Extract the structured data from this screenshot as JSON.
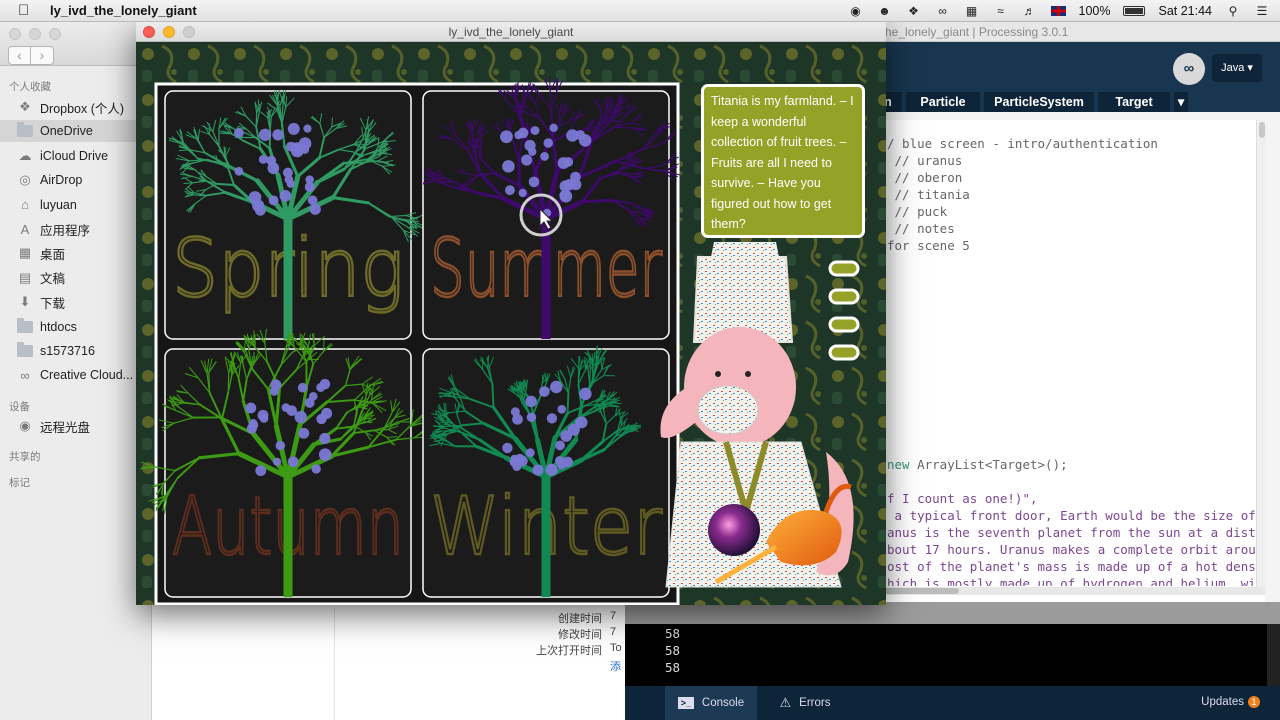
{
  "menubar": {
    "app_name": "ly_ivd_the_lonely_giant",
    "battery": "100%",
    "clock": "Sat 21:44"
  },
  "finder": {
    "sections": {
      "favorites": "个人收藏",
      "devices": "设备",
      "shared": "共享的",
      "tags": "标记"
    },
    "favorites": [
      {
        "label": "Dropbox (个人)",
        "icon": "dropbox-icon"
      },
      {
        "label": "OneDrive",
        "icon": "folder-icon",
        "selected": true
      },
      {
        "label": "iCloud Drive",
        "icon": "cloud-icon"
      },
      {
        "label": "AirDrop",
        "icon": "airdrop-icon"
      },
      {
        "label": "luyuan",
        "icon": "home-icon"
      },
      {
        "label": "应用程序",
        "icon": "applications-icon"
      },
      {
        "label": "桌面",
        "icon": "desktop-icon"
      },
      {
        "label": "文稿",
        "icon": "documents-icon"
      },
      {
        "label": "下载",
        "icon": "downloads-icon"
      },
      {
        "label": "htdocs",
        "icon": "folder-icon"
      },
      {
        "label": "s1573716",
        "icon": "folder-icon"
      },
      {
        "label": "Creative Cloud...",
        "icon": "creative-cloud-icon"
      }
    ],
    "devices": [
      {
        "label": "远程光盘",
        "icon": "disc-icon"
      }
    ],
    "info": [
      {
        "label": "创建时间",
        "value": "7"
      },
      {
        "label": "修改时间",
        "value": "7"
      },
      {
        "label": "上次打开时间",
        "value": "To"
      },
      {
        "label": "",
        "value": "添"
      }
    ]
  },
  "ide": {
    "title": "he_lonely_giant | Processing 3.0.1",
    "mode_icon": "processing-mode-icon",
    "mode": "Java ▾",
    "tabs": [
      "n",
      "Particle",
      "ParticleSystem",
      "Target",
      "▾"
    ],
    "code": [
      "/ blue screen - intro/authentication",
      " // uranus",
      " // oberon",
      " // titania",
      " // puck",
      " // notes",
      "for scene 5"
    ],
    "code_new": "new",
    "code_new_rest": " ArrayList<Target>();",
    "strings": [
      "f I count as one!)\",",
      " a typical front door, Earth would be the size of",
      "anus is the seventh planet from the sun at a dista",
      "bout 17 hours. Uranus makes a complete orbit aroun",
      "ost of the planet's mass is made up of a hot dense",
      "hich is mostly made up of hydrogen and helium  wi"
    ],
    "console": [
      "58",
      "58",
      "58"
    ],
    "footer": {
      "console": "Console",
      "errors": "Errors",
      "updates": "Updates",
      "updates_count": "1"
    }
  },
  "sketch": {
    "title": "ly_ivd_the_lonely_giant",
    "seasons": [
      {
        "label": "Spring",
        "color": "#6e6a28",
        "tree": "#2f9a62"
      },
      {
        "label": "Summer",
        "color": "#8c4f2c",
        "tree": "#3d0a6b"
      },
      {
        "label": "Autumn",
        "color": "#5c2d1d",
        "tree": "#3c9b12"
      },
      {
        "label": "Winter",
        "color": "#5f5a22",
        "tree": "#118a52"
      }
    ],
    "speech": "Titania is my farmland.\n– I keep a wonderful collection of fruit trees.\n– Fruits are all I need to survive.\n– Have you figured out how to get them?",
    "fruit_color": "#7b78d4",
    "bg_pattern_color": "#8d8a2a"
  }
}
